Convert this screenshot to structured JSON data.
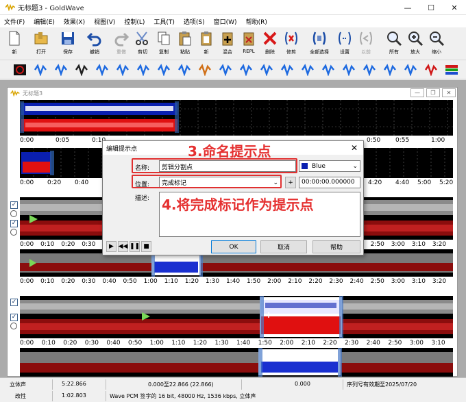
{
  "window": {
    "title": "无标题3 - GoldWave",
    "min": "—",
    "max": "☐",
    "close": "✕"
  },
  "menu": [
    "文件(F)",
    "编辑(E)",
    "效果(X)",
    "视图(V)",
    "控制(L)",
    "工具(T)",
    "选项(S)",
    "窗口(W)",
    "帮助(R)"
  ],
  "toolbar_main": [
    {
      "label": "新",
      "icon": "new-file-icon"
    },
    {
      "label": "打开",
      "icon": "open-folder-icon"
    },
    {
      "label": "保存",
      "icon": "save-icon"
    },
    {
      "label": "撤销",
      "icon": "undo-icon"
    },
    {
      "label": "重做",
      "icon": "redo-icon",
      "disabled": true
    },
    {
      "label": "剪切",
      "icon": "cut-icon"
    },
    {
      "label": "复制",
      "icon": "copy-icon"
    },
    {
      "label": "粘贴",
      "icon": "paste-icon"
    },
    {
      "label": "新",
      "icon": "paste-new-icon"
    },
    {
      "label": "混合",
      "icon": "mix-icon"
    },
    {
      "label": "REPL",
      "icon": "replace-icon"
    },
    {
      "label": "删除",
      "icon": "delete-icon"
    },
    {
      "label": "修剪",
      "icon": "trim-icon"
    },
    {
      "label": "全部选择",
      "icon": "select-all-icon"
    },
    {
      "label": "设置",
      "icon": "set-icon"
    },
    {
      "label": "以前",
      "icon": "previous-icon",
      "disabled": true
    },
    {
      "label": "所有",
      "icon": "zoom-all-icon"
    },
    {
      "label": "放大",
      "icon": "zoom-in-icon"
    },
    {
      "label": "缩小",
      "icon": "zoom-out-icon"
    }
  ],
  "effects_toolbar": [
    "stop-effect-icon",
    "resize-icon",
    "sphere-icon",
    "x-cross-icon",
    "flip-icon",
    "wave-icon",
    "wave2-icon",
    "loop-icon",
    "gear-icon",
    "colors-icon",
    "compress-icon",
    "equalizer-icon",
    "arrows-icon",
    "left-arrow-icon",
    "updown-icon",
    "sliders-icon",
    "gradient-icon",
    "bars-icon",
    "spectrum-icon",
    "split-icon",
    "lens-icon",
    "rainbow-icon"
  ],
  "document": {
    "title": "无标题3"
  },
  "ruler_top": [
    "0:00",
    "0:05",
    "0:10"
  ],
  "ruler_top_right": [
    "0:50",
    "0:55",
    "1:00"
  ],
  "ruler_mini": [
    "0:00",
    "0:20",
    "0:40"
  ],
  "ruler_mini_right": [
    "4:20",
    "4:40",
    "5:00",
    "5:20"
  ],
  "ruler_track2": [
    "0:00",
    "0:10",
    "0:20",
    "0:30",
    "0:40",
    "0:50",
    "1:00",
    "1:10",
    "1:20",
    "1:30",
    "1:40",
    "1:50",
    "2:00",
    "2:10",
    "2:20",
    "2:30",
    "2:40",
    "2:50",
    "3:00",
    "3:10",
    "3:20"
  ],
  "ruler_track3": [
    "0:00",
    "0:10",
    "0:20",
    "0:30",
    "0:40",
    "0:50",
    "1:00",
    "1:10",
    "1:20",
    "1:30",
    "1:40",
    "1:50",
    "2:00",
    "2:10",
    "2:20",
    "2:30",
    "2:40",
    "2:50",
    "3:00",
    "3:10"
  ],
  "dialog": {
    "title": "编辑提示点",
    "close": "✕",
    "name_label": "名称:",
    "name_value": "剪辑分割点",
    "color_value": "Blue",
    "position_label": "位置:",
    "position_value": "完成标记",
    "position_add": "+",
    "time_value": "00:00:00.000000",
    "desc_label": "描述:",
    "ok": "OK",
    "cancel": "取消",
    "help": "帮助"
  },
  "annotations": {
    "step3": "3.命名提示点",
    "step4": "4.将完成标记作为提示点"
  },
  "status": {
    "row1": [
      "立体声",
      "5:22.866",
      "0.000至22.866 (22.866)",
      "0.000",
      "序列号有效期至2025/07/20"
    ],
    "row2": [
      "改性",
      "1:02.803",
      "Wave PCM 签字的 16 bit, 48000 Hz, 1536 kbps, 立体声"
    ]
  },
  "colors": {
    "wave_blue": "#0a1fb0",
    "wave_red": "#e01010",
    "wave_grey": "#8a8a8a",
    "wave_darkred": "#8b0d0d",
    "annot_red": "#e53030",
    "selection": "#ffffff"
  }
}
